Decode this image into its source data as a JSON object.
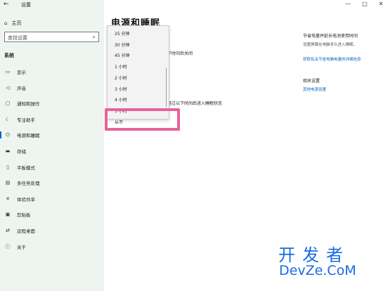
{
  "window": {
    "title": "设置",
    "back": "←",
    "minimize": "—",
    "maximize": "□",
    "close": "✕"
  },
  "nav": {
    "home_label": "主页",
    "search_placeholder": "查找设置",
    "section": "系统",
    "items": [
      {
        "icon": "▭",
        "label": "显示"
      },
      {
        "icon": "◁",
        "label": "声音"
      },
      {
        "icon": "▢",
        "label": "通知和操作"
      },
      {
        "icon": "☾",
        "label": "专注助手"
      },
      {
        "icon": "⏻",
        "label": "电源和睡眠"
      },
      {
        "icon": "▬",
        "label": "存储"
      },
      {
        "icon": "▯",
        "label": "平板模式"
      },
      {
        "icon": "▤",
        "label": "多任务处理"
      },
      {
        "icon": "✕",
        "label": "体验共享"
      },
      {
        "icon": "▣",
        "label": "剪贴板"
      },
      {
        "icon": "⇄",
        "label": "远程桌面"
      },
      {
        "icon": "ⓘ",
        "label": "关于"
      }
    ],
    "active_index": 4
  },
  "main": {
    "title": "电源和睡眠",
    "partial_1": "下时间后关闭",
    "partial_2": "经过以下时间后进入睡眠状态"
  },
  "dropdown": {
    "options": [
      "25 分钟",
      "30 分钟",
      "45 分钟",
      "1 小时",
      "2 小时",
      "3 小时",
      "4 小时",
      "5 小时",
      "从不"
    ],
    "selected": "从不"
  },
  "related": {
    "h1": "节省电量并延长电池使用时间",
    "p1": "设置屏幕在电脑多久进入睡眠。",
    "link1": "获取有关节省电脑电量的详细信息",
    "h2": "相关设置",
    "link2": "其他电源设置"
  },
  "watermark": {
    "cn": "开发者",
    "en": "DevZe.CoM"
  }
}
